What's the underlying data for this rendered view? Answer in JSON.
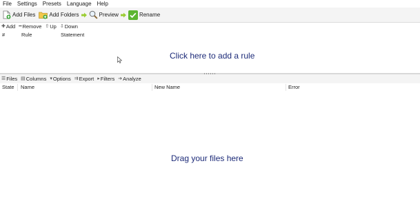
{
  "menu": [
    "File",
    "Settings",
    "Presets",
    "Language",
    "Help"
  ],
  "toolbar": {
    "add_files": "Add Files",
    "add_folders": "Add Folders",
    "preview": "Preview",
    "rename": "Rename"
  },
  "rules_toolbar": {
    "add": "Add",
    "remove": "Remove",
    "up": "Up",
    "down": "Down"
  },
  "rules_table": {
    "columns": [
      "#",
      "Rule",
      "Statement"
    ],
    "empty_hint": "Click here to add a rule"
  },
  "files_toolbar": [
    "Files",
    "Columns",
    "Options",
    "Export",
    "Filters",
    "Analyze"
  ],
  "files_table": {
    "columns": [
      "State",
      "Name",
      "New Name",
      "Error"
    ],
    "empty_hint": "Drag your files here"
  },
  "colors": {
    "hint_text": "#1c2a78",
    "toolbar_bg": "#f4f4f4",
    "add_icon_green": "#3aa63a",
    "rename_check_green": "#5cb531",
    "arrow_green": "#9acd32"
  }
}
